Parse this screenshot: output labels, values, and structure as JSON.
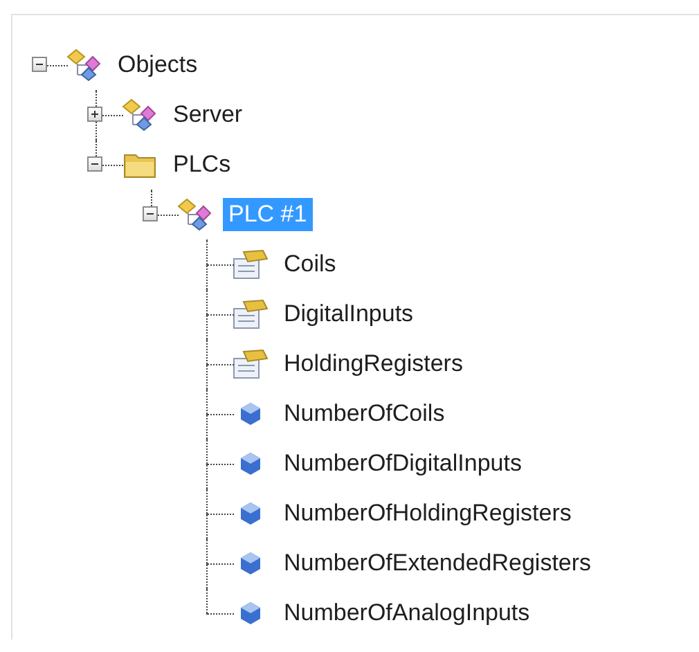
{
  "tree": [
    {
      "label": "Objects",
      "kind": "object",
      "expanded": true,
      "selected": false,
      "children": [
        {
          "label": "Server",
          "kind": "object",
          "expanded": false,
          "selected": false
        },
        {
          "label": "PLCs",
          "kind": "folder",
          "expanded": true,
          "selected": false,
          "children": [
            {
              "label": "PLC #1",
              "kind": "object",
              "expanded": true,
              "selected": true,
              "children": [
                {
                  "label": "Coils",
                  "kind": "table",
                  "selected": false
                },
                {
                  "label": "DigitalInputs",
                  "kind": "table",
                  "selected": false
                },
                {
                  "label": "HoldingRegisters",
                  "kind": "table",
                  "selected": false
                },
                {
                  "label": "NumberOfCoils",
                  "kind": "variable",
                  "selected": false
                },
                {
                  "label": "NumberOfDigitalInputs",
                  "kind": "variable",
                  "selected": false
                },
                {
                  "label": "NumberOfHoldingRegisters",
                  "kind": "variable",
                  "selected": false
                },
                {
                  "label": "NumberOfExtendedRegisters",
                  "kind": "variable",
                  "selected": false
                },
                {
                  "label": "NumberOfAnalogInputs",
                  "kind": "variable",
                  "selected": false
                }
              ]
            }
          ]
        }
      ]
    }
  ]
}
